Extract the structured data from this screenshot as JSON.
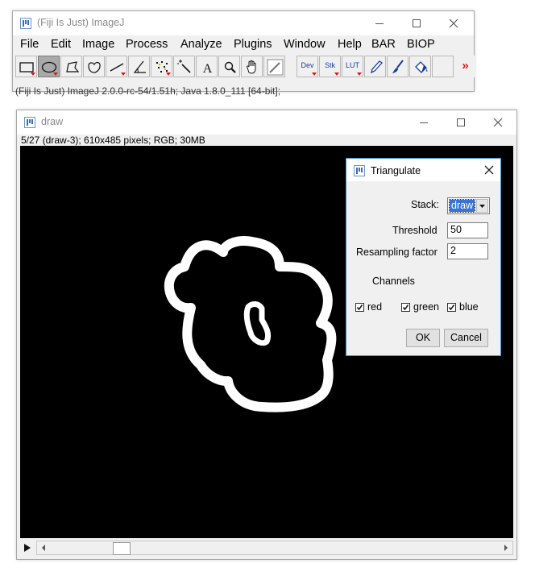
{
  "main_window": {
    "title": "(Fiji Is Just) ImageJ",
    "menus": [
      "File",
      "Edit",
      "Image",
      "Process",
      "Analyze",
      "Plugins",
      "Window",
      "Help",
      "BAR",
      "BIOP"
    ],
    "tools": [
      {
        "name": "rectangle-tool"
      },
      {
        "name": "oval-tool",
        "selected": true
      },
      {
        "name": "polygon-tool"
      },
      {
        "name": "freehand-tool"
      },
      {
        "name": "line-tool"
      },
      {
        "name": "angle-tool"
      },
      {
        "name": "point-tool"
      },
      {
        "name": "wand-tool"
      },
      {
        "name": "text-tool"
      },
      {
        "name": "zoom-tool"
      },
      {
        "name": "hand-tool"
      },
      {
        "name": "color-picker-tool"
      },
      {
        "name": "dev-tool",
        "label": "Dev"
      },
      {
        "name": "stk-tool",
        "label": "Stk"
      },
      {
        "name": "lut-tool",
        "label": "LUT"
      },
      {
        "name": "pencil-tool"
      },
      {
        "name": "brush-tool"
      },
      {
        "name": "flood-fill-tool"
      },
      {
        "name": "empty-tool"
      },
      {
        "name": "more-tools"
      }
    ],
    "more_tools_label": "»",
    "status": "(Fiji Is Just) ImageJ 2.0.0-rc-54/1.51h; Java 1.8.0_111 [64-bit];"
  },
  "image_window": {
    "title": "draw",
    "info": "5/27 (draw-3); 610x485 pixels; RGB; 30MB"
  },
  "dialog": {
    "title": "Triangulate",
    "stack_label": "Stack:",
    "stack_value": "draw",
    "threshold_label": "Threshold",
    "threshold_value": "50",
    "resampling_label": "Resampling factor",
    "resampling_value": "2",
    "channels_label": "Channels",
    "channels": [
      {
        "label": "red",
        "checked": true
      },
      {
        "label": "green",
        "checked": true
      },
      {
        "label": "blue",
        "checked": true
      }
    ],
    "ok_label": "OK",
    "cancel_label": "Cancel"
  },
  "colors": {
    "window_bg": "#f0f0f0",
    "canvas_bg": "#000000",
    "dialog_border": "#3f94d6",
    "selection_highlight": "#3874d8",
    "tool_selected": "#a9a9a9",
    "tool_arrow": "#d21a1a"
  }
}
